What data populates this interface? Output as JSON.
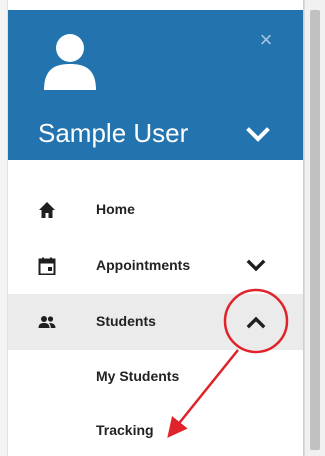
{
  "user": {
    "name": "Sample User",
    "avatar_icon": "user-avatar-icon",
    "toggle_icon": "chevron-down-icon"
  },
  "header": {
    "background": "#2273ae",
    "close_symbol": "×",
    "close_icon": "close-icon"
  },
  "nav": {
    "items": [
      {
        "label": "Home",
        "icon": "home-icon"
      },
      {
        "label": "Appointments",
        "icon": "calendar-icon",
        "chevron": "chevron-down-icon"
      },
      {
        "label": "Students",
        "icon": "people-icon",
        "chevron": "chevron-up-icon",
        "active": true
      }
    ],
    "students_submenu": [
      {
        "label": "My Students"
      },
      {
        "label": "Tracking"
      }
    ]
  },
  "annotation": {
    "color": "#e0232a"
  }
}
